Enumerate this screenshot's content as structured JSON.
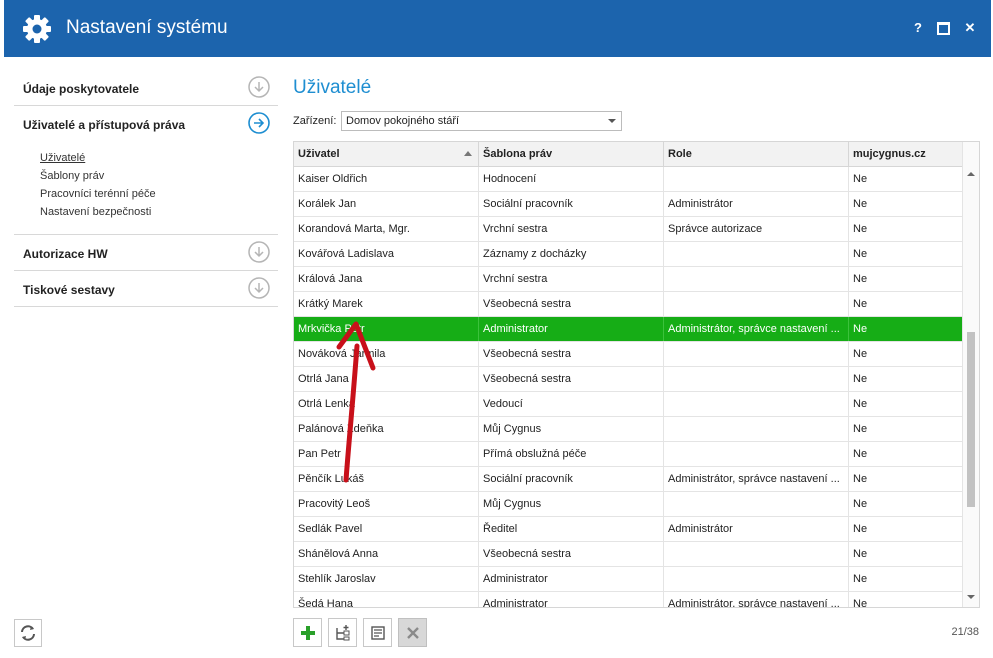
{
  "window": {
    "title": "Nastavení systému",
    "help_label": "?",
    "close_label": "✕",
    "icons": [
      "gear-icon",
      "help-icon",
      "maximize-icon",
      "close-icon"
    ]
  },
  "sidebar": {
    "sections": [
      {
        "label": "Údaje poskytovatele",
        "icon": "chevron-down-circle-icon"
      },
      {
        "label": "Uživatelé a přístupová práva",
        "icon": "arrow-right-circle-icon",
        "active": true
      },
      {
        "label": "Autorizace HW",
        "icon": "chevron-down-circle-icon"
      },
      {
        "label": "Tiskové sestavy",
        "icon": "chevron-down-circle-icon"
      }
    ],
    "subitems": [
      "Uživatelé",
      "Šablony práv",
      "Pracovníci terénní péče",
      "Nastavení bezpečnosti"
    ]
  },
  "main": {
    "title": "Uživatelé",
    "facility_label": "Zařízení:",
    "facility_value": "Domov pokojného stáří"
  },
  "grid": {
    "columns": [
      "Uživatel",
      "Šablona práv",
      "Role",
      "mujcygnus.cz"
    ],
    "sorted_column": "Uživatel",
    "rows": [
      [
        "Kaiser Oldřich",
        "Hodnocení",
        "",
        "Ne"
      ],
      [
        "Korálek Jan",
        "Sociální pracovník",
        "Administrátor",
        "Ne"
      ],
      [
        "Korandová Marta, Mgr.",
        "Vrchní sestra",
        "Správce autorizace",
        "Ne"
      ],
      [
        "Kovářová Ladislava",
        "Záznamy z docházky",
        "",
        "Ne"
      ],
      [
        "Králová Jana",
        "Vrchní sestra",
        "",
        "Ne"
      ],
      [
        "Krátký Marek",
        "Všeobecná sestra",
        "",
        "Ne"
      ],
      [
        "Mrkvička Petr",
        "Administrator",
        "Administrátor, správce nastavení ...",
        "Ne"
      ],
      [
        "Nováková Jarmila",
        "Všeobecná sestra",
        "",
        "Ne"
      ],
      [
        "Otrlá Jana",
        "Všeobecná sestra",
        "",
        "Ne"
      ],
      [
        "Otrlá Lenka",
        "Vedoucí",
        "",
        "Ne"
      ],
      [
        "Palánová Zdeňka",
        "Můj Cygnus",
        "",
        "Ne"
      ],
      [
        "Pan Petr",
        "Přímá obslužná péče",
        "",
        "Ne"
      ],
      [
        "Pěnčík Lukáš",
        "Sociální pracovník",
        "Administrátor, správce nastavení ...",
        "Ne"
      ],
      [
        "Pracovitý Leoš",
        "Můj Cygnus",
        "",
        "Ne"
      ],
      [
        "Sedlák Pavel",
        "Ředitel",
        "Administrátor",
        "Ne"
      ],
      [
        "Shánělová Anna",
        "Všeobecná sestra",
        "",
        "Ne"
      ],
      [
        "Stehlík Jaroslav",
        "Administrator",
        "",
        "Ne"
      ],
      [
        "Šedá Hana",
        "Administrator",
        "Administrátor, správce nastavení ...",
        "Ne"
      ]
    ],
    "selected_row": 6,
    "selected_color": "#16ad16"
  },
  "toolbar": {
    "buttons": [
      "add-icon",
      "add-from-template-icon",
      "edit-icon",
      "delete-icon"
    ],
    "count": "21/38"
  },
  "colors": {
    "titlebar": "#1c64ad",
    "accent": "#1e8ed1",
    "annotation_arrow": "#c8101a"
  }
}
